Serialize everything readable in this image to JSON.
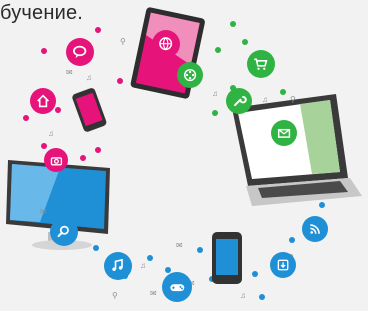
{
  "caption": "бучение.",
  "colors": {
    "magenta": "#e5137a",
    "green": "#2fb342",
    "blue": "#1f8fd6",
    "background": "#f2f2f2"
  },
  "devices": [
    "tablet",
    "smartphone-pink",
    "desktop-monitor",
    "laptop",
    "smartphone-blue"
  ],
  "icons": {
    "magenta": [
      "chat-bubble-icon",
      "home-icon",
      "camera-icon",
      "globe-cursor-icon"
    ],
    "green": [
      "film-reel-icon",
      "shopping-cart-icon",
      "wrench-icon",
      "mail-icon"
    ],
    "blue": [
      "search-icon",
      "music-note-icon",
      "gamepad-icon",
      "download-icon",
      "rss-icon"
    ]
  }
}
